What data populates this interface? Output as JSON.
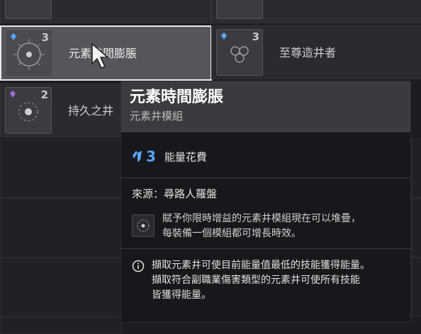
{
  "mods": [
    {
      "name": "元素時間膨脹",
      "cost": "3"
    },
    {
      "name": "至尊造井者",
      "cost": "3"
    },
    {
      "name": "持久之井",
      "cost": "2"
    }
  ],
  "tooltip": {
    "title": "元素時間膨脹",
    "subtitle": "元素井模組",
    "energy_cost": "3",
    "energy_label": "能量花費",
    "source": "來源：尋路人羅盤",
    "perk_lines": [
      "賦予你限時增益的元素井模組現在可以堆疊，",
      "每裝備一個模組都可增長時效。"
    ],
    "note_lines": [
      "擷取元素井可使目前能量值最低的技能獲得能量。",
      "擷取符合副職業傷害類型的元素井可使所有技能",
      "皆獲得能量。"
    ]
  },
  "colors": {
    "energy_blue": "#5aa6ff",
    "selected_border": "#e9e9e9",
    "tooltip_header": "#3a3b3f"
  },
  "icons": [
    "cursor-icon",
    "energy-icon",
    "info-icon"
  ]
}
